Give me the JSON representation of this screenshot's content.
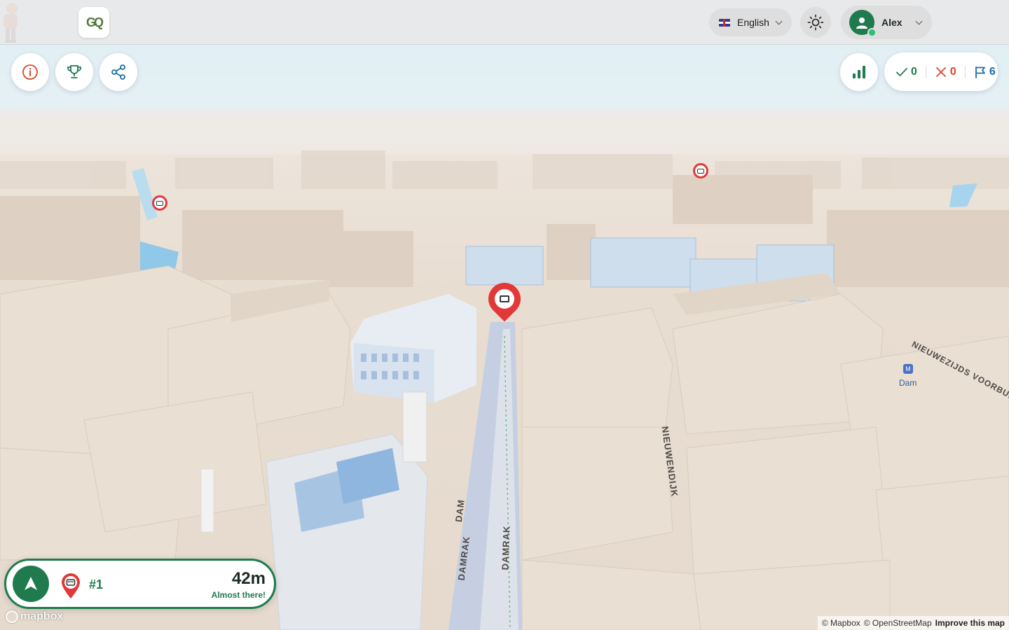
{
  "header": {
    "logo_text": "GQ",
    "language": {
      "label": "English",
      "flag": "uk-flag-icon"
    },
    "theme_icon": "sun-icon",
    "user": {
      "name": "Alex",
      "status_color": "#28c36b"
    }
  },
  "toolbar": {
    "buttons": [
      {
        "name": "info",
        "icon": "info-icon"
      },
      {
        "name": "leaderboard",
        "icon": "trophy-icon"
      },
      {
        "name": "share",
        "icon": "share-icon"
      }
    ],
    "stats_icon": "bar-chart-icon"
  },
  "score": {
    "correct": "0",
    "wrong": "0",
    "flags": "6"
  },
  "map": {
    "streets": [
      "DAM",
      "DAMRAK",
      "DAMRAK",
      "NIEUWENDIJK",
      "NIEUWEZIJDS VOORBURG"
    ],
    "poi": "Dam"
  },
  "target": {
    "number": "#1",
    "distance": "42m",
    "status": "Almost there!"
  },
  "attribution": {
    "mapbox_logo": "mapbox",
    "mapbox": "© Mapbox",
    "osm": "© OpenStreetMap",
    "improve": "Improve this map"
  },
  "colors": {
    "brand": "#1f7a4e",
    "wrong": "#d9472b",
    "flag": "#1c6fa6",
    "marker": "#e23838"
  }
}
